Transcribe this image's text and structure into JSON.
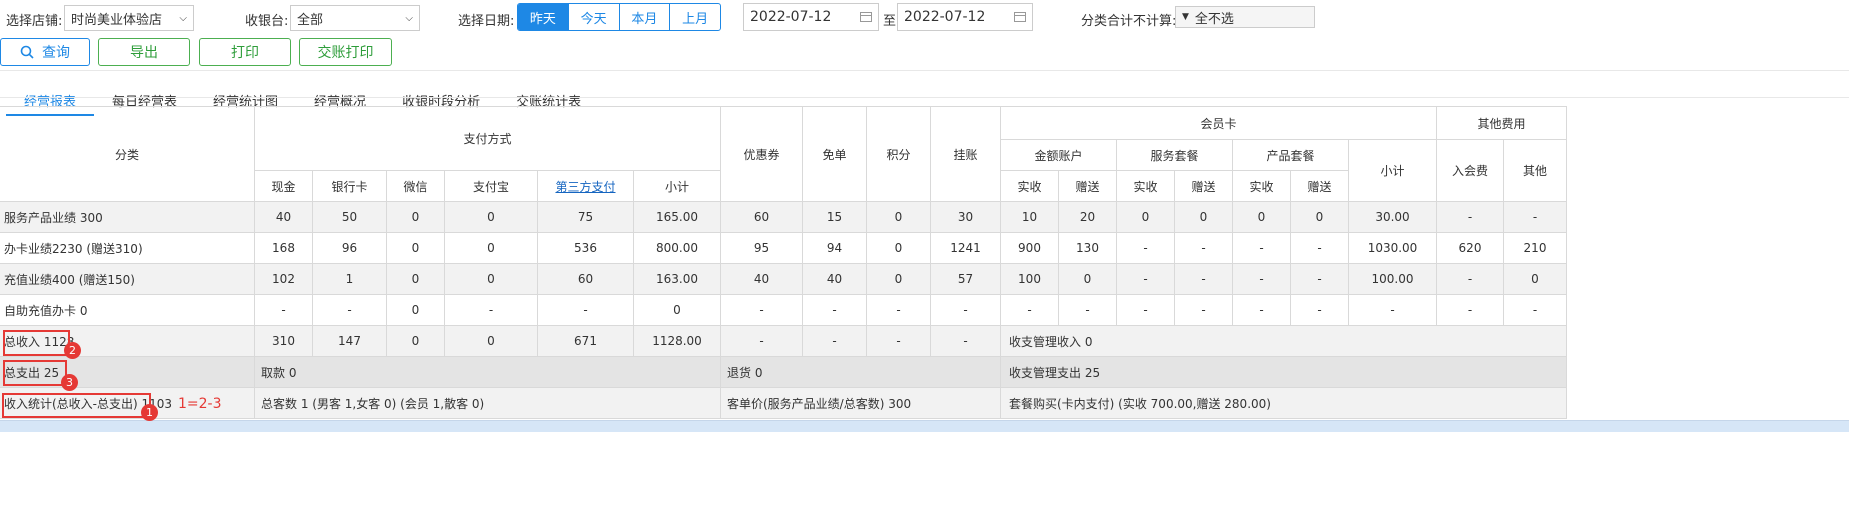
{
  "filters": {
    "store_label": "选择店铺:",
    "store_value": "时尚美业体验店",
    "cashier_label": "收银台:",
    "cashier_value": "全部",
    "date_label": "选择日期:",
    "date_buttons": [
      "昨天",
      "今天",
      "本月",
      "上月"
    ],
    "date_active": "昨天",
    "date_from": "2022-07-12",
    "date_to_label": "至",
    "date_to": "2022-07-12",
    "category_label": "分类合计不计算:",
    "category_value": "全不选"
  },
  "actions": {
    "query": "查询",
    "export": "导出",
    "print": "打印",
    "shift_print": "交账打印"
  },
  "tabs": [
    "经营报表",
    "每日经营表",
    "经营统计图",
    "经营概况",
    "收银时段分析",
    "交账统计表"
  ],
  "table": {
    "h_category": "分类",
    "h_payment": "支付方式",
    "h_pay_cols": [
      "现金",
      "银行卡",
      "微信",
      "支付宝",
      "第三方支付",
      "小计"
    ],
    "h_coupon": "优惠券",
    "h_free": "免单",
    "h_points": "积分",
    "h_credit": "挂账",
    "h_member": "会员卡",
    "h_amount_acct": "金额账户",
    "h_service_pkg": "服务套餐",
    "h_product_pkg": "产品套餐",
    "h_sub_cols": [
      "实收",
      "赠送",
      "实收",
      "赠送",
      "实收",
      "赠送"
    ],
    "h_member_subtotal": "小计",
    "h_other": "其他费用",
    "h_other_cols": [
      "入会费",
      "其他"
    ],
    "rows": [
      {
        "name": "服务产品业绩 300",
        "cells": [
          "40",
          "50",
          "0",
          "0",
          "75",
          "165.00",
          "60",
          "15",
          "0",
          "30",
          "10",
          "20",
          "0",
          "0",
          "0",
          "0",
          "30.00",
          "-",
          "-"
        ]
      },
      {
        "name": "办卡业绩2230 (赠送310)",
        "cells": [
          "168",
          "96",
          "0",
          "0",
          "536",
          "800.00",
          "95",
          "94",
          "0",
          "1241",
          "900",
          "130",
          "-",
          "-",
          "-",
          "-",
          "1030.00",
          "620",
          "210"
        ]
      },
      {
        "name": "充值业绩400 (赠送150)",
        "cells": [
          "102",
          "1",
          "0",
          "0",
          "60",
          "163.00",
          "40",
          "40",
          "0",
          "57",
          "100",
          "0",
          "-",
          "-",
          "-",
          "-",
          "100.00",
          "-",
          "0"
        ]
      },
      {
        "name": "自助充值办卡 0",
        "cells": [
          "-",
          "-",
          "0",
          "-",
          "-",
          "0",
          "-",
          "-",
          "-",
          "-",
          "-",
          "-",
          "-",
          "-",
          "-",
          "-",
          "-",
          "-",
          "-"
        ]
      }
    ],
    "total_income": {
      "name": "总收入 1128",
      "cells": [
        "310",
        "147",
        "0",
        "0",
        "671",
        "1128.00",
        "-",
        "-",
        "-",
        "-"
      ],
      "mgmt": "收支管理收入 0"
    },
    "total_expense": {
      "name": "总支出 25",
      "withdraw": "取款 0",
      "refund": "退货 0",
      "mgmt": "收支管理支出 25"
    },
    "summary": {
      "name": "收入统计(总收入-总支出) 1103",
      "customers": "总客数 1 (男客 1,女客 0) (会员 1,散客 0)",
      "avg_price": "客单价(服务产品业绩/总客数) 300",
      "pkg_purchase": "套餐购买(卡内支付) (实收 700.00,赠送 280.00)"
    }
  },
  "annotations": {
    "badge1": "1",
    "badge2": "2",
    "badge3": "3",
    "formula": "1=2-3"
  }
}
